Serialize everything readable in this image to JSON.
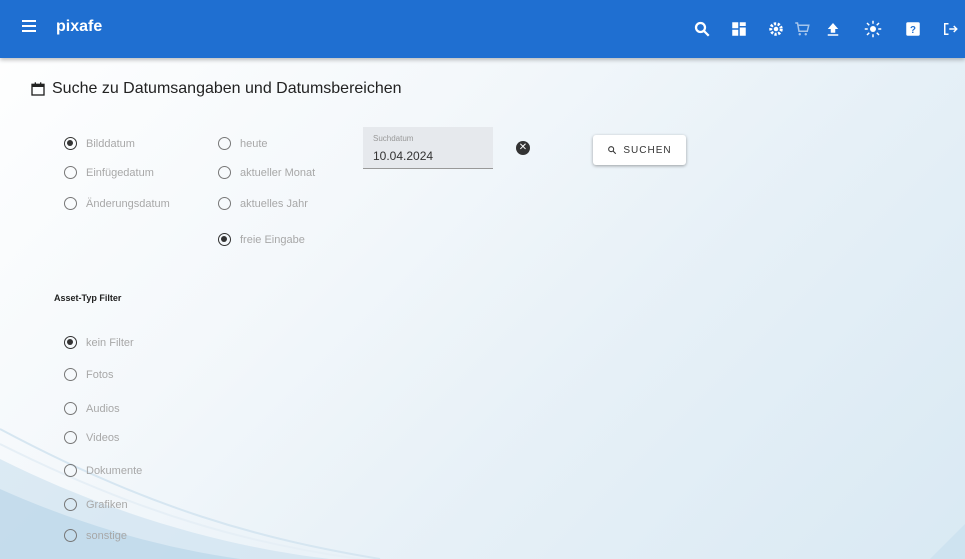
{
  "appbar": {
    "title": "pixafe",
    "icons": [
      "search-icon",
      "dashboard-icon",
      "settings-icon",
      "cart-icon",
      "upload-icon",
      "brightness-icon",
      "help-icon",
      "logout-icon"
    ]
  },
  "section": {
    "title": "Suche zu Datumsangaben und Datumsbereichen"
  },
  "date_type": {
    "options": [
      "Bilddatum",
      "Einfügedatum",
      "Änderungsdatum"
    ],
    "selected": "Bilddatum"
  },
  "date_range": {
    "options": [
      "heute",
      "aktueller Monat",
      "aktuelles Jahr",
      "freie Eingabe"
    ],
    "selected": "freie Eingabe"
  },
  "date_field": {
    "label": "Suchdatum",
    "value": "10.04.2024"
  },
  "search_button": {
    "label": "SUCHEN"
  },
  "asset_filter": {
    "heading": "Asset-Typ Filter",
    "options": [
      "kein Filter",
      "Fotos",
      "Audios",
      "Videos",
      "Dokumente",
      "Grafiken",
      "sonstige"
    ],
    "selected": "kein Filter"
  },
  "colors": {
    "appbar": "#1f6fd1",
    "background": "#e6f0f7"
  }
}
